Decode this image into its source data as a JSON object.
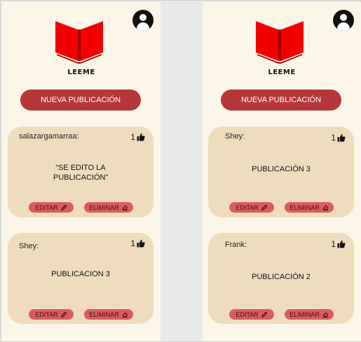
{
  "app": {
    "brand": "LEEME",
    "new_post_label": "NUEVA PUBLICACIÓN"
  },
  "actions": {
    "edit_label": "EDITAR",
    "delete_label": "ELIMINAR"
  },
  "screens": [
    {
      "posts": [
        {
          "author": "salazargamarraa:",
          "likes": "1",
          "content": "“SE EDITO LA PUBLICACIÓN”"
        },
        {
          "author": "Shey:",
          "likes": "1",
          "content": "PUBLICACION 3"
        }
      ]
    },
    {
      "posts": [
        {
          "author": "Shey:",
          "likes": "1",
          "content": "PUBLICACIÓN 3"
        },
        {
          "author": "Frank:",
          "likes": "1",
          "content": "PUBLICACIÓN 2"
        }
      ]
    }
  ],
  "colors": {
    "background": "#fbf6e7",
    "card": "#eedcbd",
    "primary": "#b7363a",
    "pill": "#db5a5d",
    "book_red": "#ff0000"
  },
  "icons": [
    "user-icon",
    "book-logo-icon",
    "thumbs-up-icon",
    "pencil-icon",
    "eraser-icon"
  ]
}
